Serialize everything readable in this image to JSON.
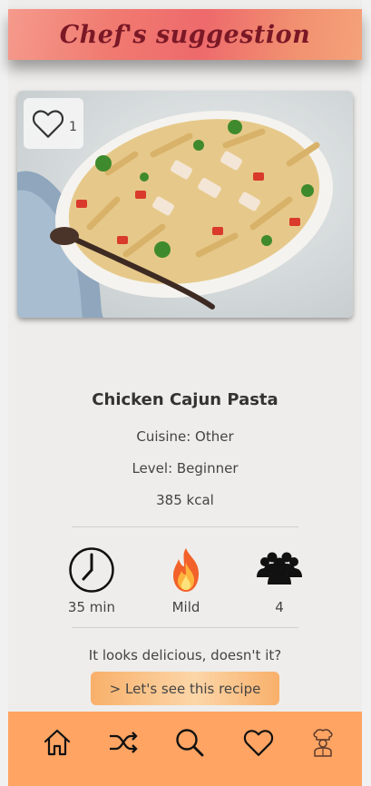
{
  "header": {
    "title": "Chef's suggestion"
  },
  "recipe": {
    "likes": "1",
    "name": "Chicken Cajun Pasta",
    "cuisine": "Cuisine: Other",
    "level": "Level: Beginner",
    "calories": "385 kcal",
    "time": "35 min",
    "spice": "Mild",
    "servings": "4",
    "prompt": "It looks delicious, doesn't it?",
    "cta_label": "> Let's see this recipe"
  },
  "icons": {
    "like": "heart-outline-icon",
    "time": "clock-icon",
    "spice": "fire-icon",
    "servings": "people-group-icon"
  },
  "nav": [
    {
      "icon": "home-icon"
    },
    {
      "icon": "shuffle-icon"
    },
    {
      "icon": "search-icon"
    },
    {
      "icon": "heart-icon"
    },
    {
      "icon": "chef-icon"
    }
  ],
  "colors": {
    "header_gradient": [
      "#f59a8c",
      "#ee6a6c",
      "#f5a27a"
    ],
    "header_title": "#7a1826",
    "cta": "#f8b06a",
    "navbar": "#ffa463",
    "background": "#eeedeb"
  }
}
